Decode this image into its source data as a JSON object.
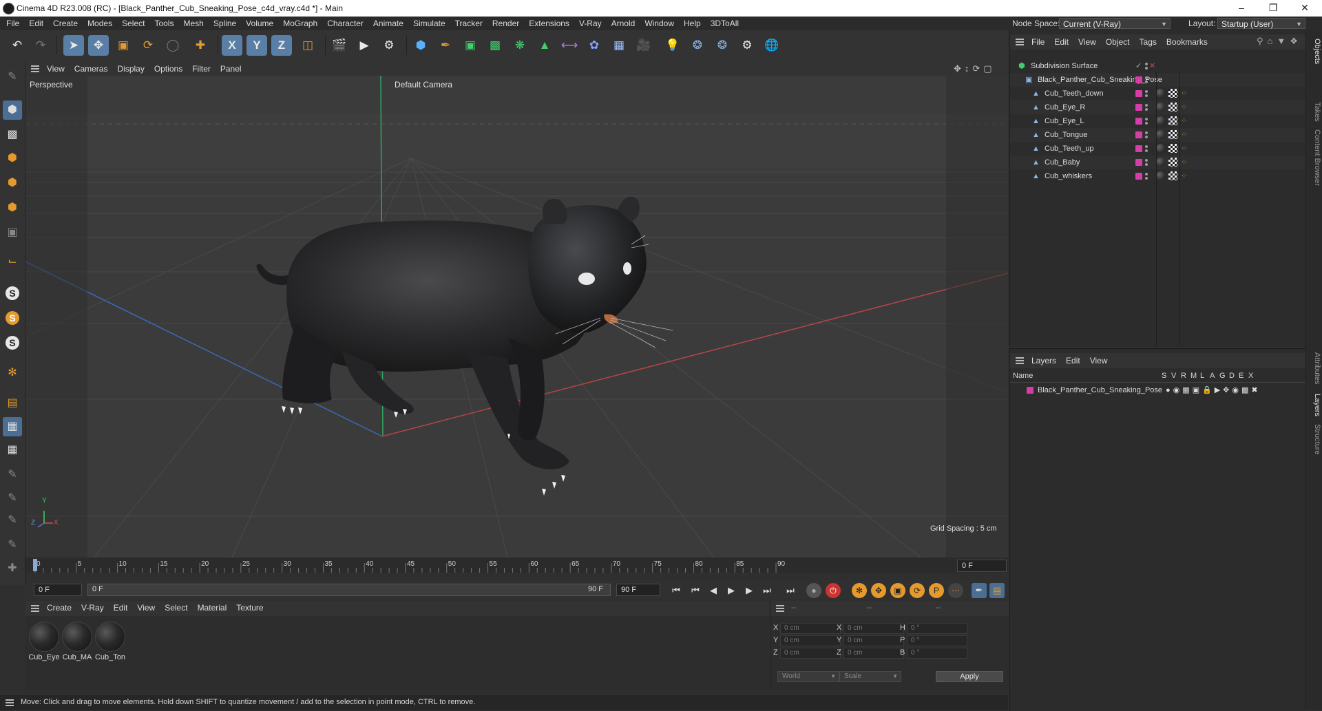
{
  "window": {
    "title": "Cinema 4D R23.008 (RC) - [Black_Panther_Cub_Sneaking_Pose_c4d_vray.c4d *] - Main"
  },
  "menubar": {
    "items": [
      "File",
      "Edit",
      "Create",
      "Modes",
      "Select",
      "Tools",
      "Mesh",
      "Spline",
      "Volume",
      "MoGraph",
      "Character",
      "Animate",
      "Simulate",
      "Tracker",
      "Render",
      "Extensions",
      "V-Ray",
      "Arnold",
      "Window",
      "Help",
      "3DToAll"
    ],
    "node_space_label": "Node Space:",
    "node_space_value": "Current (V-Ray)",
    "layout_label": "Layout:",
    "layout_value": "Startup (User)"
  },
  "viewport": {
    "menu": [
      "View",
      "Cameras",
      "Display",
      "Options",
      "Filter",
      "Panel"
    ],
    "view_name": "Perspective",
    "camera": "Default Camera",
    "grid_spacing": "Grid Spacing : 5 cm",
    "axes": {
      "x": "X",
      "y": "Y",
      "z": "Z"
    }
  },
  "timeline": {
    "ticks": [
      "0",
      "5",
      "10",
      "15",
      "20",
      "25",
      "30",
      "35",
      "40",
      "45",
      "50",
      "55",
      "60",
      "65",
      "70",
      "75",
      "80",
      "85",
      "90"
    ],
    "current_frame_right": "0 F",
    "start_field": "0 F",
    "range_start": "0 F",
    "range_end": "90 F",
    "end_field": "90 F"
  },
  "material_manager": {
    "menu": [
      "Create",
      "V-Ray",
      "Edit",
      "View",
      "Select",
      "Material",
      "Texture"
    ],
    "materials": [
      "Cub_Eye",
      "Cub_MA",
      "Cub_Ton"
    ]
  },
  "coordinates": {
    "headers": [
      "--",
      "--",
      "--"
    ],
    "rows": [
      {
        "a": "X",
        "av": "0 cm",
        "b": "X",
        "bv": "0 cm",
        "c": "H",
        "cv": "0 °"
      },
      {
        "a": "Y",
        "av": "0 cm",
        "b": "Y",
        "bv": "0 cm",
        "c": "P",
        "cv": "0 °"
      },
      {
        "a": "Z",
        "av": "0 cm",
        "b": "Z",
        "bv": "0 cm",
        "c": "B",
        "cv": "0 °"
      }
    ],
    "space": "World",
    "mode": "Scale",
    "apply": "Apply"
  },
  "status": {
    "text": "Move: Click and drag to move elements. Hold down SHIFT to quantize movement / add to the selection in point mode, CTRL to remove."
  },
  "objects": {
    "menu": [
      "File",
      "Edit",
      "View",
      "Object",
      "Tags",
      "Bookmarks"
    ],
    "root": "Subdivision Surface",
    "group": "Black_Panther_Cub_Sneaking_Pose",
    "children": [
      "Cub_Teeth_down",
      "Cub_Eye_R",
      "Cub_Eye_L",
      "Cub_Tongue",
      "Cub_Teeth_up",
      "Cub_Baby",
      "Cub_whiskers"
    ]
  },
  "layers": {
    "menu": [
      "Layers",
      "Edit",
      "View"
    ],
    "name_header": "Name",
    "flags": [
      "S",
      "V",
      "R",
      "M",
      "L",
      "A",
      "G",
      "D",
      "E",
      "X"
    ],
    "items": [
      "Black_Panther_Cub_Sneaking_Pose"
    ]
  },
  "side_tabs": [
    "Objects",
    "Takes",
    "Content Browser",
    "Attributes",
    "Layers",
    "Structure"
  ],
  "colors": {
    "accent": "#5a7fa6",
    "layer": "#d43ea6",
    "orange": "#e49a2c"
  }
}
